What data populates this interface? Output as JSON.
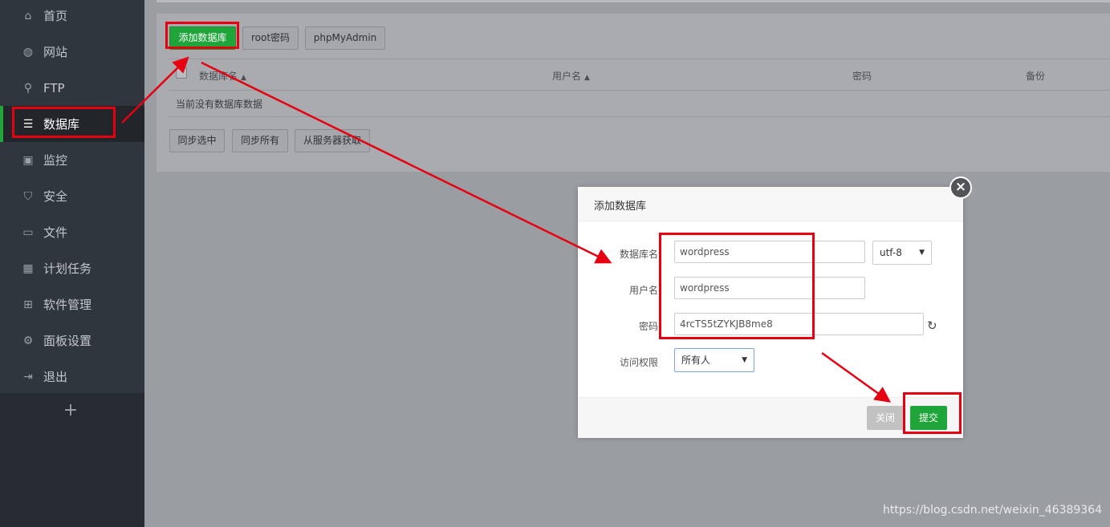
{
  "sidebar": {
    "items": [
      {
        "label": "首页",
        "icon": "home-icon",
        "glyph": "⌂"
      },
      {
        "label": "网站",
        "icon": "globe-icon",
        "glyph": "◍"
      },
      {
        "label": "FTP",
        "icon": "ftp-icon",
        "glyph": "⚲"
      },
      {
        "label": "数据库",
        "icon": "database-icon",
        "glyph": "☰",
        "active": true
      },
      {
        "label": "监控",
        "icon": "monitor-icon",
        "glyph": "▣"
      },
      {
        "label": "安全",
        "icon": "shield-icon",
        "glyph": "⛉"
      },
      {
        "label": "文件",
        "icon": "folder-icon",
        "glyph": "▭"
      },
      {
        "label": "计划任务",
        "icon": "calendar-icon",
        "glyph": "▦"
      },
      {
        "label": "软件管理",
        "icon": "apps-icon",
        "glyph": "⊞"
      },
      {
        "label": "面板设置",
        "icon": "gear-icon",
        "glyph": "⚙"
      },
      {
        "label": "退出",
        "icon": "logout-icon",
        "glyph": "⇥"
      }
    ],
    "add_glyph": "+"
  },
  "toolbar": {
    "add_database": "添加数据库",
    "root_password": "root密码",
    "phpmyadmin": "phpMyAdmin"
  },
  "table": {
    "columns": [
      "数据库名",
      "用户名",
      "密码",
      "备份"
    ],
    "sort_glyph": "▲",
    "empty_text": "当前没有数据库数据"
  },
  "sync_buttons": {
    "sync_selected": "同步选中",
    "sync_all": "同步所有",
    "fetch_from_server": "从服务器获取"
  },
  "modal": {
    "title": "添加数据库",
    "close_glyph": "×",
    "fields": {
      "db_name_label": "数据库名",
      "db_name_value": "wordpress",
      "charset_value": "utf-8",
      "username_label": "用户名",
      "username_value": "wordpress",
      "password_label": "密码",
      "password_value": "4rcTS5tZYKJB8me8",
      "access_label": "访问权限",
      "access_value": "所有人"
    },
    "refresh_glyph": "↻",
    "close_button": "关闭",
    "submit_button": "提交"
  },
  "caret_glyph": "▼",
  "watermark": "https://blog.csdn.net/weixin_46389364",
  "colors": {
    "accent_green": "#20a53a",
    "annotation_red": "#e60012",
    "sidebar_bg": "#30363e"
  }
}
